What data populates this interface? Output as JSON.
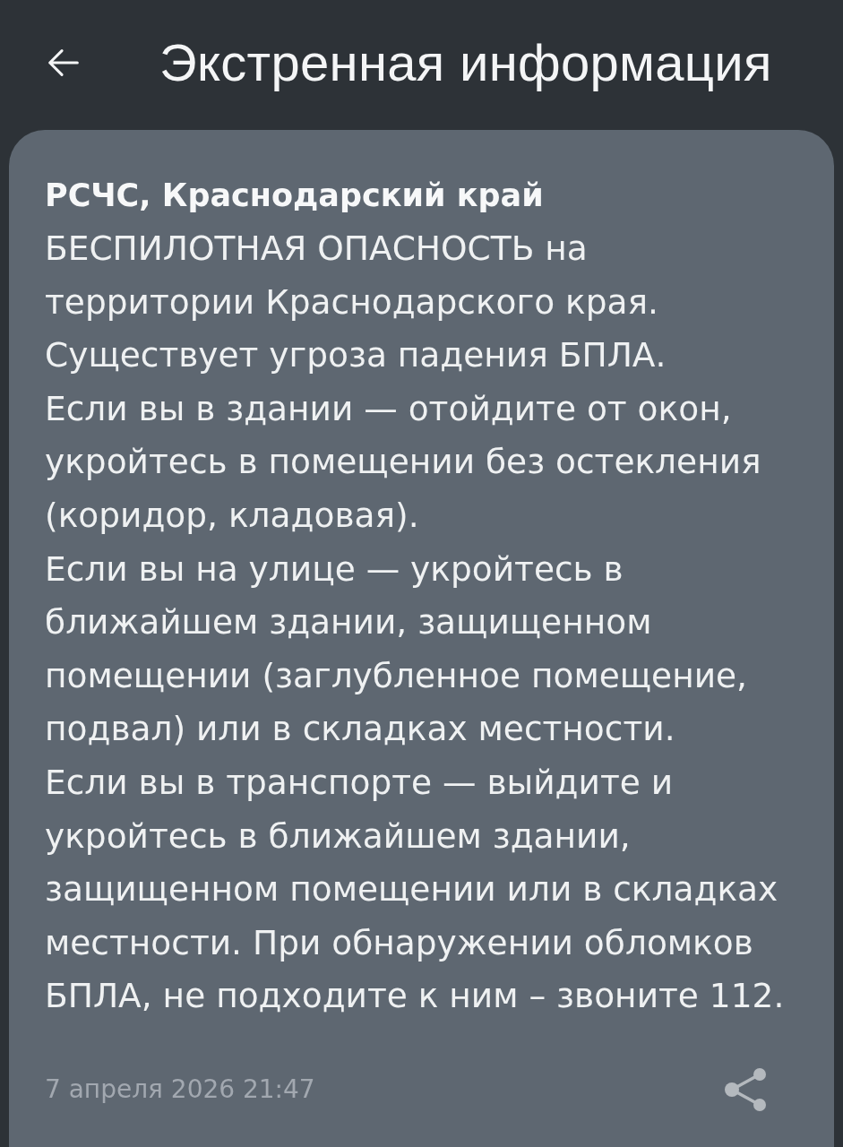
{
  "header": {
    "title": "Экстренная информация"
  },
  "alert": {
    "sender": "РСЧС, Краснодарский край",
    "paragraphs": [
      "БЕСПИЛОТНАЯ ОПАСНОСТЬ на территории Краснодарского края.",
      "Существует угроза падения БПЛА.",
      "Если вы в здании — отойдите от окон, укройтесь в помещении без остекления (коридор, кладовая).",
      "Если вы на улице — укройтесь в ближайшем здании, защищенном помещении (заглубленное помещение, подвал) или в складках местности.",
      "Если вы в транспорте — выйдите и укройтесь в ближайшем здании, защищенном помещении или в складках местности. При обнаружении обломков БПЛА, не подходите к ним – звоните 112."
    ],
    "timestamp": "7 апреля 2026 21:47"
  }
}
